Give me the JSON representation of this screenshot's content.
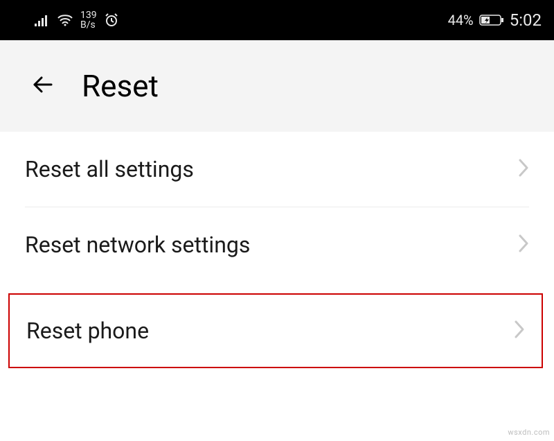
{
  "status_bar": {
    "net_speed_value": "139",
    "net_speed_unit": "B/s",
    "battery_percent": "44%",
    "time": "5:02"
  },
  "header": {
    "title": "Reset"
  },
  "settings": {
    "items": [
      {
        "label": "Reset all settings",
        "highlighted": false
      },
      {
        "label": "Reset network settings",
        "highlighted": false
      },
      {
        "label": "Reset phone",
        "highlighted": true
      }
    ]
  },
  "watermark": "wsxdn.com"
}
